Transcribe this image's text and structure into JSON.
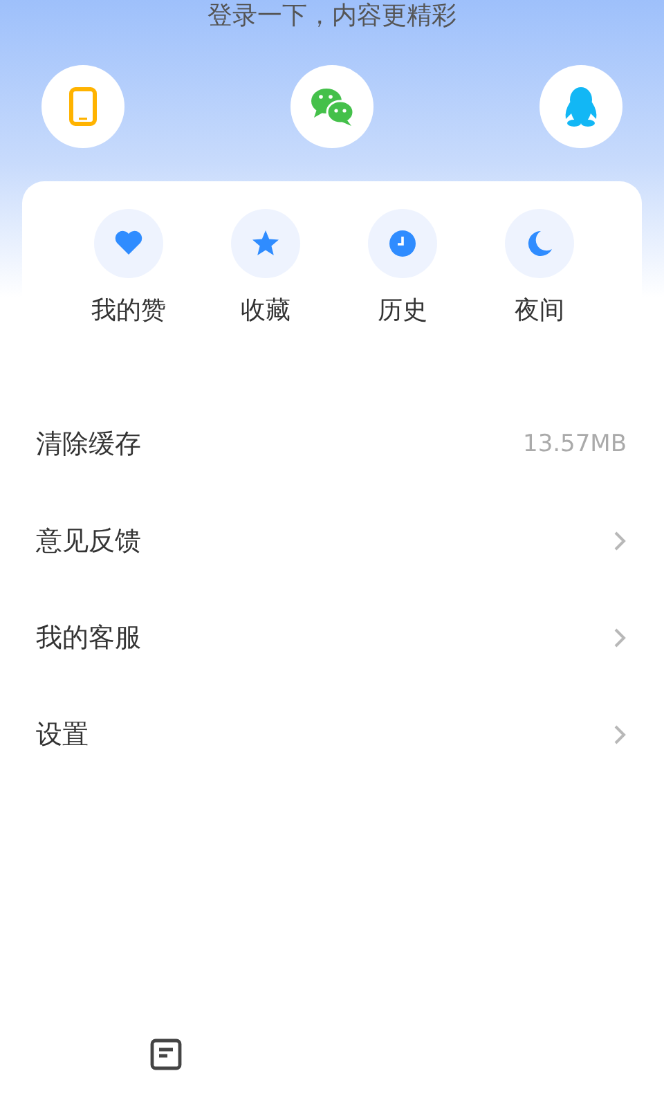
{
  "login_prompt": "登录一下，内容更精彩",
  "login_options": [
    {
      "kind": "phone"
    },
    {
      "kind": "wechat"
    },
    {
      "kind": "qq"
    }
  ],
  "shortcuts": [
    {
      "kind": "heart",
      "label": "我的赞"
    },
    {
      "kind": "star",
      "label": "收藏"
    },
    {
      "kind": "clock",
      "label": "历史"
    },
    {
      "kind": "moon",
      "label": "夜间"
    }
  ],
  "menu": [
    {
      "kind": "value",
      "label": "清除缓存",
      "value": "13.57MB"
    },
    {
      "kind": "link",
      "label": "意见反馈"
    },
    {
      "kind": "link",
      "label": "我的客服"
    },
    {
      "kind": "link",
      "label": "设置"
    }
  ],
  "bottom_nav": [
    {
      "kind": "document"
    }
  ]
}
